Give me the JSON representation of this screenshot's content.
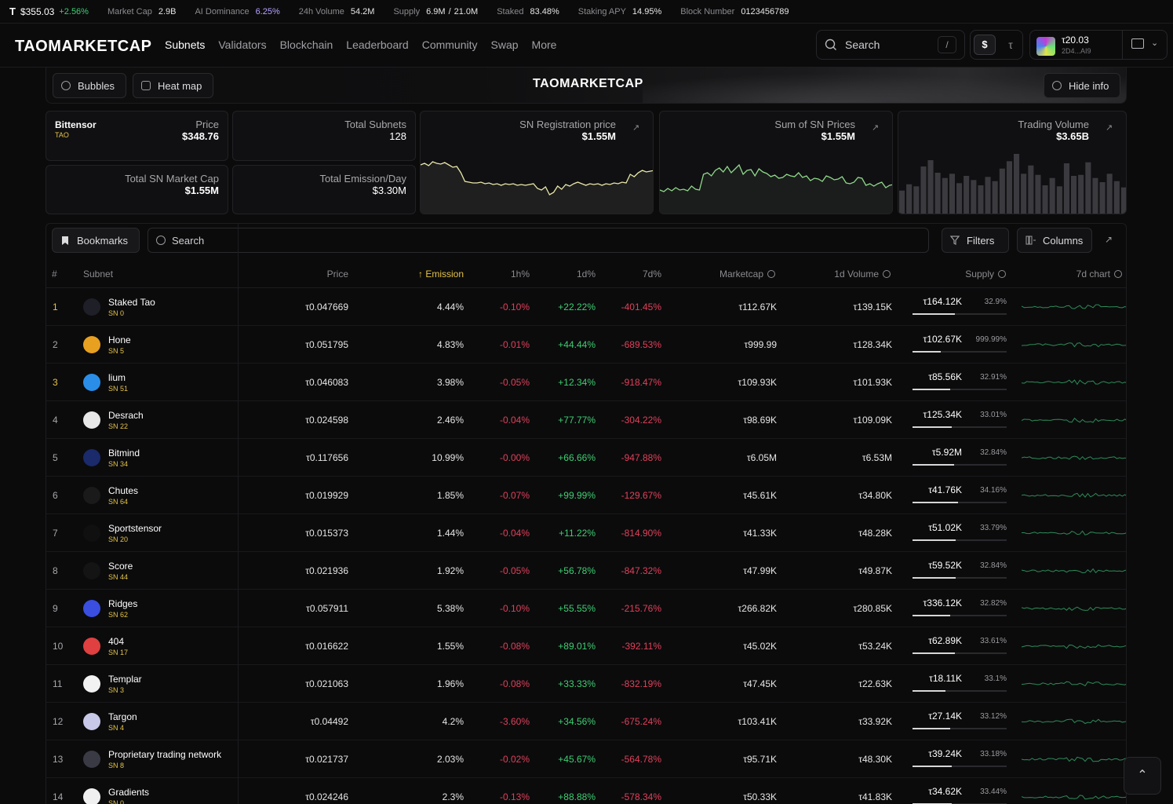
{
  "ticker": {
    "tao_symbol": "T",
    "price": "$355.03",
    "change": "+2.56%",
    "market_cap_label": "Market Cap",
    "market_cap": "2.9B",
    "ai_dominance_label": "AI Dominance",
    "ai_dominance": "6.25%",
    "volume_label": "24h Volume",
    "volume": "54.2M",
    "supply_label": "Supply",
    "supply_circ": "6.9M",
    "supply_sep": "/",
    "supply_max": "21.0M",
    "staked_label": "Staked",
    "staked": "83.48%",
    "apy_label": "Staking APY",
    "apy": "14.95%",
    "block_label": "Block Number",
    "block": "0123456789"
  },
  "nav": {
    "logo": "TAOMARKETCAP",
    "links": [
      "Subnets",
      "Validators",
      "Blockchain",
      "Leaderboard",
      "Community",
      "Swap",
      "More"
    ],
    "search_placeholder": "Search",
    "search_shortcut": "/",
    "currency_usd": "$",
    "currency_tao": "τ",
    "wallet_balance": "τ20.03",
    "wallet_address": "2D4...AI9"
  },
  "banner": {
    "bubbles": "Bubbles",
    "heatmap": "Heat map",
    "title": "TAOMARKETCAP",
    "hide_info": "Hide info"
  },
  "stats": {
    "bittensor_name": "Bittensor",
    "bittensor_symbol": "TAO",
    "price_label": "Price",
    "price": "$348.76",
    "total_subnets_label": "Total Subnets",
    "total_subnets": "128",
    "mcap_label": "Total SN Market Cap",
    "mcap": "$1.55M",
    "emission_label": "Total Emission/Day",
    "emission": "$3.30M",
    "reg_label": "SN Registration price",
    "reg": "$1.55M",
    "sum_label": "Sum of SN Prices",
    "sum": "$1.55M",
    "tv_label": "Trading Volume",
    "tv": "$3.65B",
    "reg_series": [
      62,
      64,
      61,
      66,
      64,
      63,
      65,
      62,
      59,
      60,
      52,
      41,
      40,
      39,
      39,
      40,
      38,
      39,
      37,
      38,
      36,
      38,
      37,
      38,
      36,
      37,
      36,
      37,
      38,
      32,
      30,
      34,
      24,
      27,
      35,
      31,
      37,
      35,
      38,
      40,
      38,
      36,
      38,
      37,
      38,
      36,
      38,
      37,
      39,
      38,
      40,
      39,
      50,
      47,
      52,
      55,
      53,
      54,
      55
    ],
    "sum_series": [
      30,
      28,
      32,
      29,
      33,
      30,
      31,
      29,
      35,
      31,
      30,
      50,
      52,
      48,
      55,
      58,
      53,
      60,
      52,
      57,
      62,
      50,
      55,
      56,
      48,
      57,
      53,
      51,
      47,
      49,
      45,
      46,
      50,
      48,
      47,
      52,
      46,
      48,
      42,
      45,
      44,
      41,
      48,
      46,
      43,
      44,
      47,
      39,
      38,
      40,
      46,
      45,
      36,
      38,
      35,
      38,
      40,
      33,
      36,
      37
    ],
    "tv_bars": [
      22,
      28,
      26,
      45,
      51,
      39,
      34,
      38,
      29,
      36,
      32,
      27,
      35,
      31,
      43,
      50,
      57,
      38,
      46,
      37,
      27,
      34,
      26,
      48,
      36,
      37,
      49,
      34,
      30,
      38,
      31,
      25
    ]
  },
  "table": {
    "bookmarks": "Bookmarks",
    "search_placeholder": "Search",
    "filters": "Filters",
    "columns": "Columns",
    "headers": {
      "rank": "#",
      "subnet": "Subnet",
      "price": "Price",
      "emission": "Emission",
      "h1": "1h%",
      "d1": "1d%",
      "d7": "7d%",
      "marketcap": "Marketcap",
      "volume": "1d Volume",
      "supply": "Supply",
      "chart": "7d chart"
    },
    "rows": [
      {
        "rank": "1",
        "name": "Staked Tao",
        "sn": "SN 0",
        "price": "τ0.047669",
        "emission": "4.44%",
        "h1": "-0.10%",
        "d1": "+22.22%",
        "d7": "-401.45%",
        "mcap": "τ112.67K",
        "vol": "τ139.15K",
        "supply": "τ164.12K",
        "supply_pct": "32.9%",
        "fill": 0.45,
        "gold": true,
        "icon": "#1f1f28"
      },
      {
        "rank": "2",
        "name": "Hone",
        "sn": "SN 5",
        "price": "τ0.051795",
        "emission": "4.83%",
        "h1": "-0.01%",
        "d1": "+44.44%",
        "d7": "-689.53%",
        "mcap": "τ999.99",
        "vol": "τ128.34K",
        "supply": "τ102.67K",
        "supply_pct": "999.99%",
        "fill": 0.3,
        "gold": false,
        "icon": "#e8a020"
      },
      {
        "rank": "3",
        "name": "lium",
        "sn": "SN 51",
        "price": "τ0.046083",
        "emission": "3.98%",
        "h1": "-0.05%",
        "d1": "+12.34%",
        "d7": "-918.47%",
        "mcap": "τ109.93K",
        "vol": "τ101.93K",
        "supply": "τ85.56K",
        "supply_pct": "32.91%",
        "fill": 0.4,
        "gold": true,
        "icon": "#2a8ee8"
      },
      {
        "rank": "4",
        "name": "Desrach",
        "sn": "SN 22",
        "price": "τ0.024598",
        "emission": "2.46%",
        "h1": "-0.04%",
        "d1": "+77.77%",
        "d7": "-304.22%",
        "mcap": "τ98.69K",
        "vol": "τ109.09K",
        "supply": "τ125.34K",
        "supply_pct": "33.01%",
        "fill": 0.42,
        "gold": false,
        "icon": "#e8e8e8"
      },
      {
        "rank": "5",
        "name": "Bitmind",
        "sn": "SN 34",
        "price": "τ0.117656",
        "emission": "10.99%",
        "h1": "-0.00%",
        "d1": "+66.66%",
        "d7": "-947.88%",
        "mcap": "τ6.05M",
        "vol": "τ6.53M",
        "supply": "τ5.92M",
        "supply_pct": "32.84%",
        "fill": 0.44,
        "gold": false,
        "icon": "#1a2a6a"
      },
      {
        "rank": "6",
        "name": "Chutes",
        "sn": "SN 64",
        "price": "τ0.019929",
        "emission": "1.85%",
        "h1": "-0.07%",
        "d1": "+99.99%",
        "d7": "-129.67%",
        "mcap": "τ45.61K",
        "vol": "τ34.80K",
        "supply": "τ41.76K",
        "supply_pct": "34.16%",
        "fill": 0.48,
        "gold": false,
        "icon": "#1a1a1a"
      },
      {
        "rank": "7",
        "name": "Sportstensor",
        "sn": "SN 20",
        "price": "τ0.015373",
        "emission": "1.44%",
        "h1": "-0.04%",
        "d1": "+11.22%",
        "d7": "-814.90%",
        "mcap": "τ41.33K",
        "vol": "τ48.28K",
        "supply": "τ51.02K",
        "supply_pct": "33.79%",
        "fill": 0.46,
        "gold": false,
        "icon": "#101010"
      },
      {
        "rank": "8",
        "name": "Score",
        "sn": "SN 44",
        "price": "τ0.021936",
        "emission": "1.92%",
        "h1": "-0.05%",
        "d1": "+56.78%",
        "d7": "-847.32%",
        "mcap": "τ47.99K",
        "vol": "τ49.87K",
        "supply": "τ59.52K",
        "supply_pct": "32.84%",
        "fill": 0.46,
        "gold": false,
        "icon": "#141414"
      },
      {
        "rank": "9",
        "name": "Ridges",
        "sn": "SN 62",
        "price": "τ0.057911",
        "emission": "5.38%",
        "h1": "-0.10%",
        "d1": "+55.55%",
        "d7": "-215.76%",
        "mcap": "τ266.82K",
        "vol": "τ280.85K",
        "supply": "τ336.12K",
        "supply_pct": "32.82%",
        "fill": 0.4,
        "gold": false,
        "icon": "#3a4ee0"
      },
      {
        "rank": "10",
        "name": "404",
        "sn": "SN 17",
        "price": "τ0.016622",
        "emission": "1.55%",
        "h1": "-0.08%",
        "d1": "+89.01%",
        "d7": "-392.11%",
        "mcap": "τ45.02K",
        "vol": "τ53.24K",
        "supply": "τ62.89K",
        "supply_pct": "33.61%",
        "fill": 0.45,
        "gold": false,
        "icon": "#e04040"
      },
      {
        "rank": "11",
        "name": "Templar",
        "sn": "SN 3",
        "price": "τ0.021063",
        "emission": "1.96%",
        "h1": "-0.08%",
        "d1": "+33.33%",
        "d7": "-832.19%",
        "mcap": "τ47.45K",
        "vol": "τ22.63K",
        "supply": "τ18.11K",
        "supply_pct": "33.1%",
        "fill": 0.35,
        "gold": false,
        "icon": "#f2f2f2"
      },
      {
        "rank": "12",
        "name": "Targon",
        "sn": "SN 4",
        "price": "τ0.04492",
        "emission": "4.2%",
        "h1": "-3.60%",
        "d1": "+34.56%",
        "d7": "-675.24%",
        "mcap": "τ103.41K",
        "vol": "τ33.92K",
        "supply": "τ27.14K",
        "supply_pct": "33.12%",
        "fill": 0.4,
        "gold": false,
        "icon": "#c8c8e8"
      },
      {
        "rank": "13",
        "name": "Proprietary trading network",
        "sn": "SN 8",
        "price": "τ0.021737",
        "emission": "2.03%",
        "h1": "-0.02%",
        "d1": "+45.67%",
        "d7": "-564.78%",
        "mcap": "τ95.71K",
        "vol": "τ48.30K",
        "supply": "τ39.24K",
        "supply_pct": "33.18%",
        "fill": 0.42,
        "gold": false,
        "icon": "#3a3a44"
      },
      {
        "rank": "14",
        "name": "Gradients",
        "sn": "SN 0",
        "price": "τ0.024246",
        "emission": "2.3%",
        "h1": "-0.13%",
        "d1": "+88.88%",
        "d7": "-578.34%",
        "mcap": "τ50.33K",
        "vol": "τ41.83K",
        "supply": "τ34.62K",
        "supply_pct": "33.44%",
        "fill": 0.42,
        "gold": false,
        "icon": "#f0f0f0"
      }
    ]
  }
}
